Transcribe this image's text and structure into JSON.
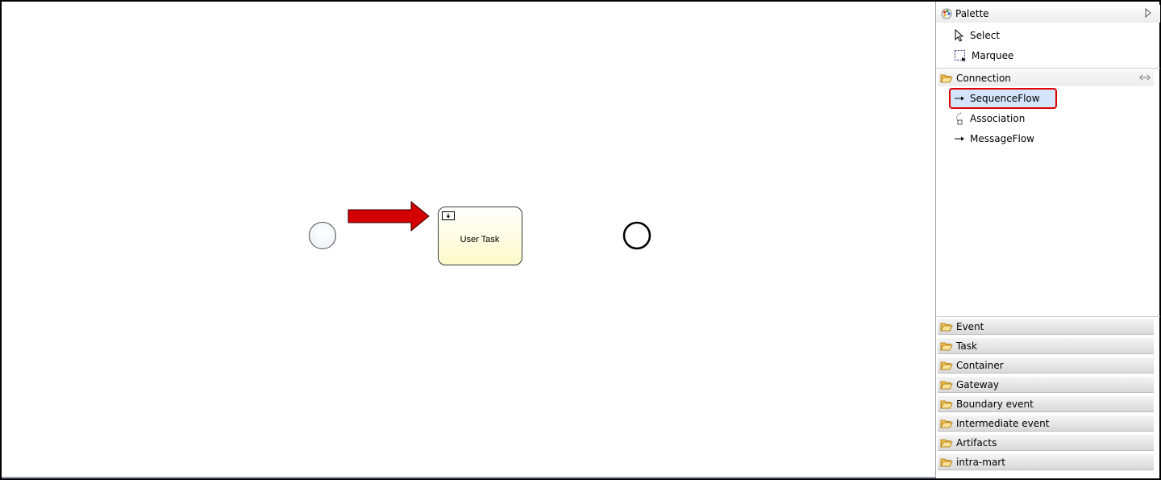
{
  "diagram": {
    "task_label": "User Task"
  },
  "palette": {
    "title": "Palette",
    "tools": [
      {
        "label": "Select",
        "icon": "pointer-icon"
      },
      {
        "label": "Marquee",
        "icon": "marquee-icon"
      }
    ],
    "connection": {
      "label": "Connection",
      "items": [
        {
          "label": "SequenceFlow",
          "icon": "arrow-right-icon",
          "selected": true
        },
        {
          "label": "Association",
          "icon": "association-icon"
        },
        {
          "label": "MessageFlow",
          "icon": "arrow-right-icon"
        }
      ]
    },
    "sections": [
      "Event",
      "Task",
      "Container",
      "Gateway",
      "Boundary event",
      "Intermediate event",
      "Artifacts",
      "intra-mart"
    ]
  },
  "colors": {
    "highlight_border": "#e00000",
    "selected_bg": "#d4e5fb",
    "arrow_fill": "#d40000",
    "task_fill_top": "#ffffff",
    "task_fill_bottom": "#fdf9c8"
  }
}
